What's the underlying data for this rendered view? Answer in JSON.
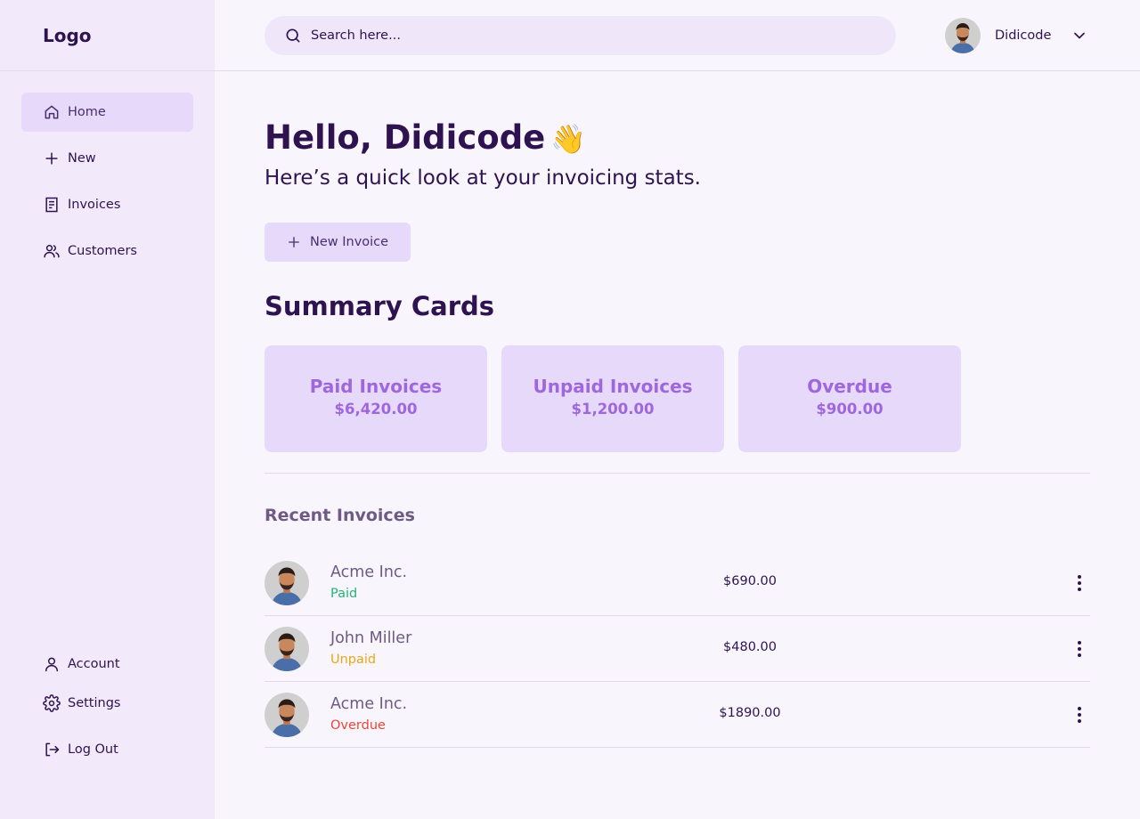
{
  "brand": {
    "logo": "Logo"
  },
  "sidebar": {
    "items": [
      {
        "label": "Home",
        "icon": "home-icon",
        "active": true
      },
      {
        "label": "New",
        "icon": "plus-icon"
      },
      {
        "label": "Invoices",
        "icon": "document-icon"
      },
      {
        "label": "Customers",
        "icon": "users-icon"
      }
    ],
    "bottom_items": [
      {
        "label": "Account",
        "icon": "user-icon"
      },
      {
        "label": "Settings",
        "icon": "gear-icon"
      },
      {
        "label": "Log Out",
        "icon": "logout-icon"
      }
    ]
  },
  "header": {
    "search": {
      "placeholder": "Search here..."
    },
    "user": {
      "name": "Didicode"
    }
  },
  "main": {
    "greeting": "Hello, Didicode",
    "greeting_emoji": "👋",
    "subtitle": "Here’s a quick look at your invoicing stats.",
    "new_invoice_label": "New Invoice",
    "summary_title": "Summary Cards",
    "cards": [
      {
        "title": "Paid Invoices",
        "value": "$6,420.00"
      },
      {
        "title": "Unpaid Invoices",
        "value": "$1,200.00"
      },
      {
        "title": "Overdue",
        "value": "$900.00"
      }
    ],
    "recent_title": "Recent Invoices",
    "invoices": [
      {
        "name": "Acme Inc.",
        "status": "Paid",
        "status_color": "#22b573",
        "amount": "$690.00"
      },
      {
        "name": "John Miller",
        "status": "Unpaid",
        "status_color": "#e6a817",
        "amount": "$480.00"
      },
      {
        "name": "Acme Inc.",
        "status": "Overdue",
        "status_color": "#f04438",
        "amount": "$1890.00"
      }
    ]
  },
  "colors": {
    "accent": "#9f67de",
    "accent_bg": "#e7d9fa",
    "text": "#2e1350",
    "sidebar_bg": "#f2eafb",
    "page_bg": "#f8f5fd"
  }
}
